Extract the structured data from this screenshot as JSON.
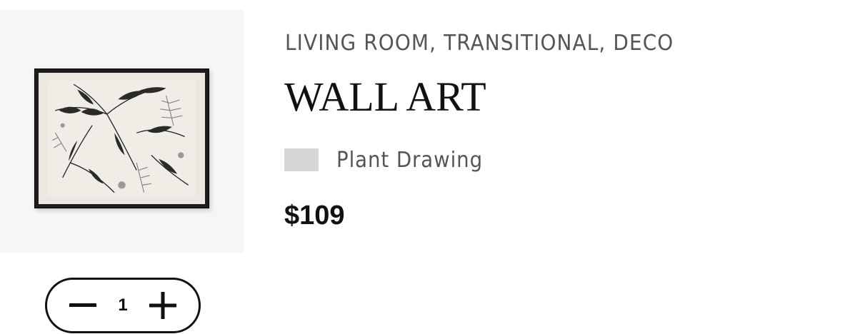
{
  "product": {
    "category": "LIVING ROOM, TRANSITIONAL, DECO",
    "title": "WALL ART",
    "variant": {
      "name": "Plant Drawing",
      "swatch_color": "#d6d6d6"
    },
    "price": "$109",
    "image_icon": "framed-botanical-print"
  },
  "quantity": {
    "value": "1",
    "decrement_icon": "minus-icon",
    "increment_icon": "plus-icon"
  }
}
